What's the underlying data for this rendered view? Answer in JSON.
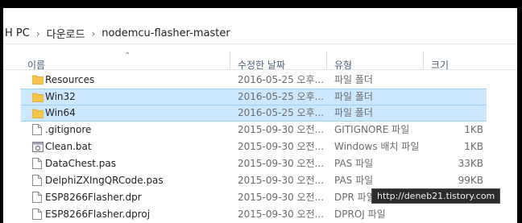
{
  "breadcrumb": {
    "items": [
      "H PC",
      "다운로드",
      "nodemcu-flasher-master"
    ]
  },
  "columns": {
    "name": "이름",
    "date": "수정한 날짜",
    "type": "유형",
    "size": "크기"
  },
  "files": [
    {
      "name": "Resources",
      "date": "2016-05-25 오후...",
      "type": "파일 폴더",
      "size": "",
      "icon": "folder-icon",
      "selected": false
    },
    {
      "name": "Win32",
      "date": "2016-05-25 오후...",
      "type": "파일 폴더",
      "size": "",
      "icon": "folder-icon",
      "selected": true
    },
    {
      "name": "Win64",
      "date": "2016-05-25 오후...",
      "type": "파일 폴더",
      "size": "",
      "icon": "folder-icon",
      "selected": true
    },
    {
      "name": ".gitignore",
      "date": "2015-09-30 오전...",
      "type": "GITIGNORE 파일",
      "size": "1KB",
      "icon": "file-icon",
      "selected": false
    },
    {
      "name": "Clean.bat",
      "date": "2015-09-30 오전...",
      "type": "Windows 배치 파일",
      "size": "1KB",
      "icon": "batch-file-icon",
      "selected": false
    },
    {
      "name": "DataChest.pas",
      "date": "2015-09-30 오전...",
      "type": "PAS 파일",
      "size": "33KB",
      "icon": "file-icon",
      "selected": false
    },
    {
      "name": "DelphiZXIngQRCode.pas",
      "date": "2015-09-30 오전...",
      "type": "PAS 파일",
      "size": "99KB",
      "icon": "file-icon",
      "selected": false
    },
    {
      "name": "ESP8266Flasher.dpr",
      "date": "2015-09-30 오전...",
      "type": "DPR 파일",
      "size": "",
      "icon": "file-icon",
      "selected": false
    },
    {
      "name": "ESP8266Flasher.dproj",
      "date": "2015-09-30 오전...",
      "type": "DPROJ 파일",
      "size": "",
      "icon": "file-icon",
      "selected": false
    }
  ],
  "watermark": "http://deneb21.tistory.com"
}
